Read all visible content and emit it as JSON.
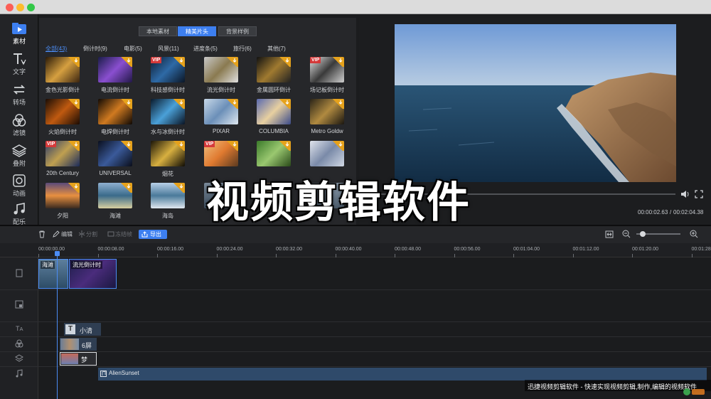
{
  "sidebar": {
    "items": [
      {
        "label": "素材",
        "icon": "media-folder-icon"
      },
      {
        "label": "文字",
        "icon": "text-icon"
      },
      {
        "label": "转场",
        "icon": "transition-icon"
      },
      {
        "label": "滤镜",
        "icon": "filter-icon"
      },
      {
        "label": "叠附",
        "icon": "overlay-layers-icon"
      },
      {
        "label": "动画",
        "icon": "animation-icon"
      },
      {
        "label": "配乐",
        "icon": "music-icon"
      }
    ]
  },
  "library": {
    "tabs": [
      "本地素材",
      "精美片头",
      "背景样例"
    ],
    "categories": [
      "全部(43)",
      "倒计时(9)",
      "电影(5)",
      "风景(11)",
      "进度条(5)",
      "旅行(6)",
      "其他(7)"
    ],
    "items": [
      "金色光影倒计",
      "电流倒计时",
      "科技感倒计时",
      "流光倒计时",
      "金属圆环倒计",
      "场记板倒计时",
      "火焰倒计时",
      "电焊倒计时",
      "水与冰倒计时",
      "PIXAR",
      "COLUMBIA",
      "Metro Goldw",
      "20th Century",
      "UNIVERSAL",
      "烟花",
      "",
      "",
      "",
      "夕阳",
      "海滩",
      "海岛",
      "",
      "",
      ""
    ]
  },
  "preview": {
    "current_time": "00:00:02.63",
    "total_time": "00:02:04.38"
  },
  "toolbar": {
    "edit": "编辑",
    "split": "分割",
    "freeze": "冻结帧",
    "export": "导出"
  },
  "ruler": {
    "ticks": [
      "00:00:00.00",
      "00:00:08.00",
      "00:00:16.00",
      "00:00:24.00",
      "00:00:32.00",
      "00:00:40.00",
      "00:00:48.00",
      "00:00:56.00",
      "00:01:04.00",
      "00:01:12.00",
      "00:01:20.00",
      "00:01:28"
    ]
  },
  "timeline": {
    "clip1": "海滩",
    "clip2": "流光倒计时",
    "text_clip": "小清",
    "filter_clip": "6屏",
    "overlay_clip": "梦",
    "music_clip": "AlienSunset"
  },
  "overlay": {
    "watermark": "视频剪辑软件",
    "caption": "迅捷视频剪辑软件 - 快速实现视频剪辑,制作,编辑的视频软件"
  },
  "colors": {
    "accent": "#3d7ff0",
    "vip_red": "#d53a3a",
    "download_badge": "#e6a21c",
    "playhead": "#4b8cf4"
  }
}
